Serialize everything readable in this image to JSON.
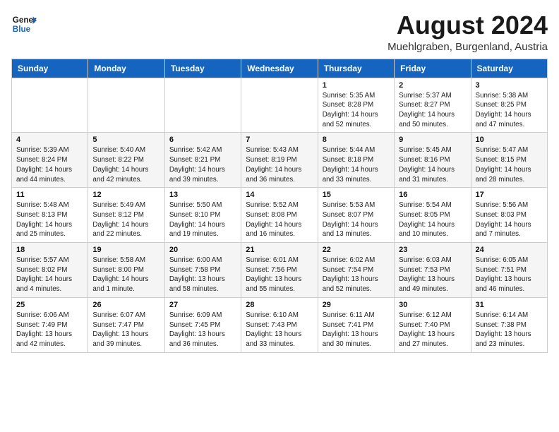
{
  "header": {
    "logo_general": "General",
    "logo_blue": "Blue",
    "month": "August 2024",
    "location": "Muehlgraben, Burgenland, Austria"
  },
  "weekdays": [
    "Sunday",
    "Monday",
    "Tuesday",
    "Wednesday",
    "Thursday",
    "Friday",
    "Saturday"
  ],
  "weeks": [
    [
      {
        "day": "",
        "info": ""
      },
      {
        "day": "",
        "info": ""
      },
      {
        "day": "",
        "info": ""
      },
      {
        "day": "",
        "info": ""
      },
      {
        "day": "1",
        "info": "Sunrise: 5:35 AM\nSunset: 8:28 PM\nDaylight: 14 hours\nand 52 minutes."
      },
      {
        "day": "2",
        "info": "Sunrise: 5:37 AM\nSunset: 8:27 PM\nDaylight: 14 hours\nand 50 minutes."
      },
      {
        "day": "3",
        "info": "Sunrise: 5:38 AM\nSunset: 8:25 PM\nDaylight: 14 hours\nand 47 minutes."
      }
    ],
    [
      {
        "day": "4",
        "info": "Sunrise: 5:39 AM\nSunset: 8:24 PM\nDaylight: 14 hours\nand 44 minutes."
      },
      {
        "day": "5",
        "info": "Sunrise: 5:40 AM\nSunset: 8:22 PM\nDaylight: 14 hours\nand 42 minutes."
      },
      {
        "day": "6",
        "info": "Sunrise: 5:42 AM\nSunset: 8:21 PM\nDaylight: 14 hours\nand 39 minutes."
      },
      {
        "day": "7",
        "info": "Sunrise: 5:43 AM\nSunset: 8:19 PM\nDaylight: 14 hours\nand 36 minutes."
      },
      {
        "day": "8",
        "info": "Sunrise: 5:44 AM\nSunset: 8:18 PM\nDaylight: 14 hours\nand 33 minutes."
      },
      {
        "day": "9",
        "info": "Sunrise: 5:45 AM\nSunset: 8:16 PM\nDaylight: 14 hours\nand 31 minutes."
      },
      {
        "day": "10",
        "info": "Sunrise: 5:47 AM\nSunset: 8:15 PM\nDaylight: 14 hours\nand 28 minutes."
      }
    ],
    [
      {
        "day": "11",
        "info": "Sunrise: 5:48 AM\nSunset: 8:13 PM\nDaylight: 14 hours\nand 25 minutes."
      },
      {
        "day": "12",
        "info": "Sunrise: 5:49 AM\nSunset: 8:12 PM\nDaylight: 14 hours\nand 22 minutes."
      },
      {
        "day": "13",
        "info": "Sunrise: 5:50 AM\nSunset: 8:10 PM\nDaylight: 14 hours\nand 19 minutes."
      },
      {
        "day": "14",
        "info": "Sunrise: 5:52 AM\nSunset: 8:08 PM\nDaylight: 14 hours\nand 16 minutes."
      },
      {
        "day": "15",
        "info": "Sunrise: 5:53 AM\nSunset: 8:07 PM\nDaylight: 14 hours\nand 13 minutes."
      },
      {
        "day": "16",
        "info": "Sunrise: 5:54 AM\nSunset: 8:05 PM\nDaylight: 14 hours\nand 10 minutes."
      },
      {
        "day": "17",
        "info": "Sunrise: 5:56 AM\nSunset: 8:03 PM\nDaylight: 14 hours\nand 7 minutes."
      }
    ],
    [
      {
        "day": "18",
        "info": "Sunrise: 5:57 AM\nSunset: 8:02 PM\nDaylight: 14 hours\nand 4 minutes."
      },
      {
        "day": "19",
        "info": "Sunrise: 5:58 AM\nSunset: 8:00 PM\nDaylight: 14 hours\nand 1 minute."
      },
      {
        "day": "20",
        "info": "Sunrise: 6:00 AM\nSunset: 7:58 PM\nDaylight: 13 hours\nand 58 minutes."
      },
      {
        "day": "21",
        "info": "Sunrise: 6:01 AM\nSunset: 7:56 PM\nDaylight: 13 hours\nand 55 minutes."
      },
      {
        "day": "22",
        "info": "Sunrise: 6:02 AM\nSunset: 7:54 PM\nDaylight: 13 hours\nand 52 minutes."
      },
      {
        "day": "23",
        "info": "Sunrise: 6:03 AM\nSunset: 7:53 PM\nDaylight: 13 hours\nand 49 minutes."
      },
      {
        "day": "24",
        "info": "Sunrise: 6:05 AM\nSunset: 7:51 PM\nDaylight: 13 hours\nand 46 minutes."
      }
    ],
    [
      {
        "day": "25",
        "info": "Sunrise: 6:06 AM\nSunset: 7:49 PM\nDaylight: 13 hours\nand 42 minutes."
      },
      {
        "day": "26",
        "info": "Sunrise: 6:07 AM\nSunset: 7:47 PM\nDaylight: 13 hours\nand 39 minutes."
      },
      {
        "day": "27",
        "info": "Sunrise: 6:09 AM\nSunset: 7:45 PM\nDaylight: 13 hours\nand 36 minutes."
      },
      {
        "day": "28",
        "info": "Sunrise: 6:10 AM\nSunset: 7:43 PM\nDaylight: 13 hours\nand 33 minutes."
      },
      {
        "day": "29",
        "info": "Sunrise: 6:11 AM\nSunset: 7:41 PM\nDaylight: 13 hours\nand 30 minutes."
      },
      {
        "day": "30",
        "info": "Sunrise: 6:12 AM\nSunset: 7:40 PM\nDaylight: 13 hours\nand 27 minutes."
      },
      {
        "day": "31",
        "info": "Sunrise: 6:14 AM\nSunset: 7:38 PM\nDaylight: 13 hours\nand 23 minutes."
      }
    ]
  ]
}
